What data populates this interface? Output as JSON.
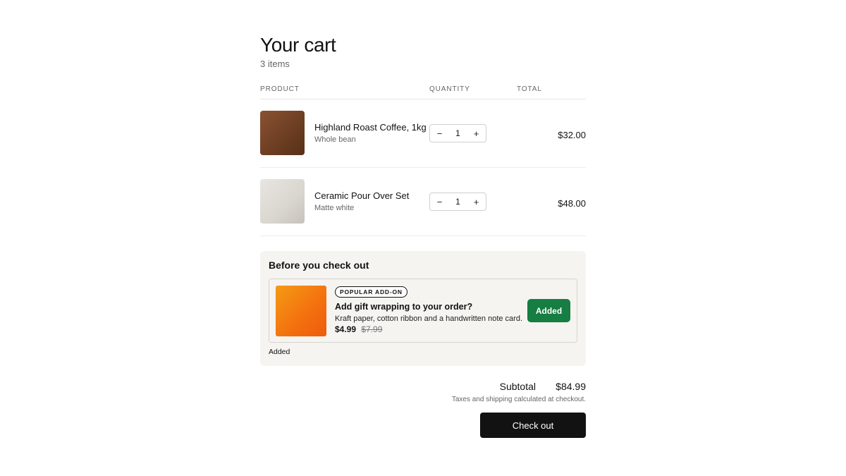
{
  "header": {
    "title": "Your cart",
    "item_count": "3 items"
  },
  "table": {
    "headers": {
      "product": "Product",
      "quantity": "Quantity",
      "total": "Total"
    }
  },
  "items": [
    {
      "name": "Highland Roast Coffee, 1kg",
      "variant": "Whole bean",
      "quantity": "1",
      "total": "$32.00",
      "thumb_color": "#6b3d22"
    },
    {
      "name": "Ceramic Pour Over Set",
      "variant": "Matte white",
      "quantity": "1",
      "total": "$48.00",
      "thumb_color": "#d9d5cf"
    }
  ],
  "qty_controls": {
    "decrement": "−",
    "increment": "+"
  },
  "upsell": {
    "heading": "Before you check out",
    "badge": "POPULAR ADD-ON",
    "title": "Add gift wrapping to your order?",
    "description": "Kraft paper, cotton ribbon and a handwritten note card.",
    "price": "$4.99",
    "original_price": "$7.99",
    "button_label": "Added",
    "status": "Added",
    "thumb_color": "#f3700f",
    "button_color": "#167d43"
  },
  "summary": {
    "subtotal_label": "Subtotal",
    "subtotal_value": "$84.99",
    "tax_note": "Taxes and shipping calculated at checkout.",
    "checkout_label": "Check out"
  }
}
